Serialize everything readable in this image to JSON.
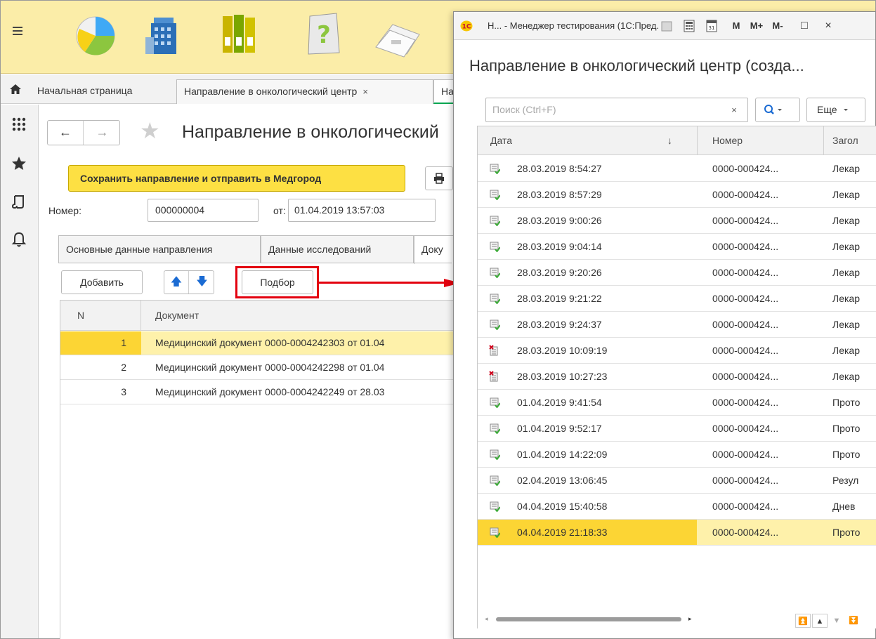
{
  "main": {
    "tabs": [
      {
        "label": "Начальная страница"
      },
      {
        "label": "Направление в онкологический центр",
        "close": "×"
      },
      {
        "label": "На"
      }
    ],
    "nav": {
      "back": "←",
      "forward": "→"
    },
    "doc_title": "Направление в онкологический",
    "save_button": "Сохранить направление и отправить в Медгород",
    "number_label": "Номер:",
    "number_value": "000000004",
    "from_label": "от:",
    "date_value": "01.04.2019 13:57:03",
    "form_tabs": [
      {
        "label": "Основные данные направления"
      },
      {
        "label": "Данные исследований"
      },
      {
        "label": "Доку"
      }
    ],
    "toolbar": {
      "add": "Добавить",
      "up": "🡅",
      "down": "🡇",
      "pick": "Подбор"
    },
    "table": {
      "headers": {
        "n": "N",
        "doc": "Документ"
      },
      "rows": [
        {
          "n": "1",
          "doc": "Медицинский документ 0000-0004242303 от 01.04"
        },
        {
          "n": "2",
          "doc": "Медицинский документ 0000-0004242298 от 01.04"
        },
        {
          "n": "3",
          "doc": "Медицинский документ 0000-0004242249 от 28.03"
        }
      ]
    }
  },
  "popup": {
    "window_title": "Н... - Менеджер тестирования (1С:Пред.",
    "toolbar": {
      "m": "M",
      "mplus": "M+",
      "mminus": "M-",
      "restore": "□",
      "close": "×"
    },
    "heading": "Направление в онкологический центр (созда...",
    "search_placeholder": "Поиск (Ctrl+F)",
    "search_clear": "×",
    "more_button": "Еще",
    "table": {
      "headers": {
        "date": "Дата",
        "sort": "↓",
        "num": "Номер",
        "title": "Загол"
      },
      "rows": [
        {
          "date": "28.03.2019 8:54:27",
          "num": "0000-000424...",
          "title": "Лекар",
          "status": "ok"
        },
        {
          "date": "28.03.2019 8:57:29",
          "num": "0000-000424...",
          "title": "Лекар",
          "status": "ok"
        },
        {
          "date": "28.03.2019 9:00:26",
          "num": "0000-000424...",
          "title": "Лекар",
          "status": "ok"
        },
        {
          "date": "28.03.2019 9:04:14",
          "num": "0000-000424...",
          "title": "Лекар",
          "status": "ok"
        },
        {
          "date": "28.03.2019 9:20:26",
          "num": "0000-000424...",
          "title": "Лекар",
          "status": "ok"
        },
        {
          "date": "28.03.2019 9:21:22",
          "num": "0000-000424...",
          "title": "Лекар",
          "status": "ok"
        },
        {
          "date": "28.03.2019 9:24:37",
          "num": "0000-000424...",
          "title": "Лекар",
          "status": "ok"
        },
        {
          "date": "28.03.2019 10:09:19",
          "num": "0000-000424...",
          "title": "Лекар",
          "status": "deleted"
        },
        {
          "date": "28.03.2019 10:27:23",
          "num": "0000-000424...",
          "title": "Лекар",
          "status": "deleted"
        },
        {
          "date": "01.04.2019 9:41:54",
          "num": "0000-000424...",
          "title": "Прото",
          "status": "ok"
        },
        {
          "date": "01.04.2019 9:52:17",
          "num": "0000-000424...",
          "title": "Прото",
          "status": "ok"
        },
        {
          "date": "01.04.2019 14:22:09",
          "num": "0000-000424...",
          "title": "Прото",
          "status": "ok"
        },
        {
          "date": "02.04.2019 13:06:45",
          "num": "0000-000424...",
          "title": "Резул",
          "status": "ok"
        },
        {
          "date": "04.04.2019 15:40:58",
          "num": "0000-000424...",
          "title": "Днев",
          "status": "ok"
        },
        {
          "date": "04.04.2019 21:18:33",
          "num": "0000-000424...",
          "title": "Прото",
          "status": "ok"
        }
      ]
    }
  },
  "colors": {
    "accent_yellow": "#fde043",
    "selected_row": "#fcd534",
    "highlight_red": "#e3000f",
    "topbar": "#fbeda8"
  }
}
